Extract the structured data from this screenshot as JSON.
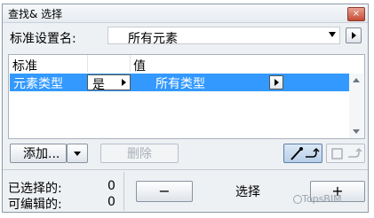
{
  "window": {
    "title": "查找& 选择",
    "close_label": "×"
  },
  "settings": {
    "label": "标准设置名:",
    "value": "所有元素"
  },
  "criteria": {
    "header_criterion": "标准",
    "header_value": "值",
    "row": {
      "criterion": "元素类型",
      "operator": "是",
      "value": "所有类型"
    }
  },
  "actions": {
    "add_label": "添加...",
    "delete_label": "删除"
  },
  "stats": {
    "selected_label": "已选择的:",
    "selected_value": "0",
    "editable_label": "可编辑的:",
    "editable_value": "0"
  },
  "selection": {
    "minus_label": "−",
    "select_label": "选择",
    "plus_label": "+"
  },
  "watermark": "TopsBIM"
}
